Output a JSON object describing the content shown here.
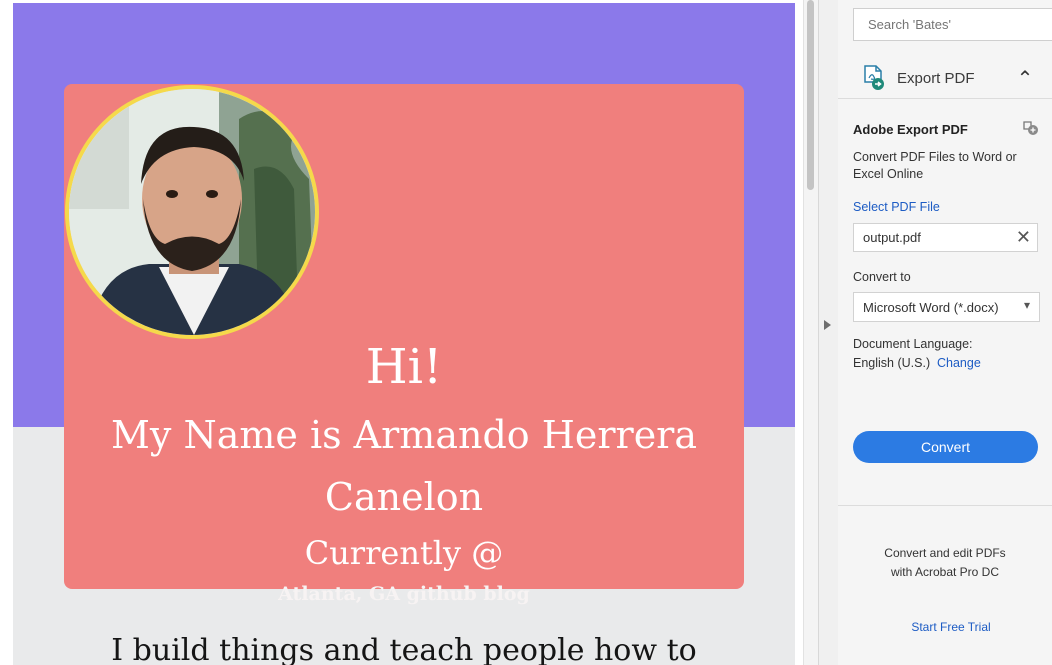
{
  "document": {
    "greeting": "Hi!",
    "name_line1": "My Name is Armando Herrera",
    "name_line2": "Canelon",
    "current_line": "Currently @",
    "links_line": "Atlanta, GA github blog",
    "tagline": "I build things and teach people how to",
    "colors": {
      "hero_bg": "#8b79ea",
      "card": "#f07f7d",
      "page_bg": "#e9eaeb",
      "avatar_border": "#f5d94b"
    }
  },
  "panel": {
    "search_placeholder": "Search 'Bates'",
    "tool_title": "Export PDF",
    "tool_icon": "export-pdf-icon",
    "section_title": "Adobe Export PDF",
    "section_desc": "Convert PDF Files to Word or Excel Online",
    "select_file_label": "Select PDF File",
    "file_name": "output.pdf",
    "convert_to_label": "Convert to",
    "format_value": "Microsoft Word (*.docx)",
    "lang_label": "Document Language:",
    "lang_value": "English (U.S.)",
    "lang_change": "Change",
    "convert_button": "Convert",
    "promo_line1": "Convert and edit PDFs",
    "promo_line2": "with Acrobat Pro DC",
    "trial_link": "Start Free Trial",
    "accent": "#2c7be3"
  }
}
